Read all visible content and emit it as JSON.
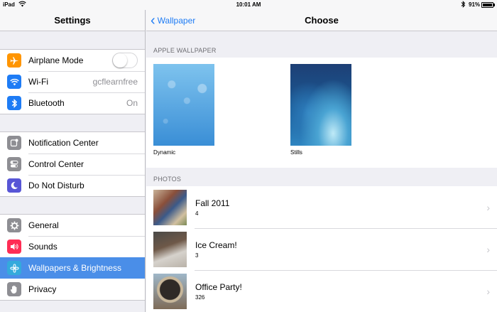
{
  "status_bar": {
    "device": "iPad",
    "wifi_icon": "wifi-icon",
    "time": "10:01 AM",
    "bluetooth_icon": "bluetooth-icon",
    "battery": "91%"
  },
  "sidebar": {
    "title": "Settings",
    "groups": [
      [
        {
          "label": "Airplane Mode",
          "icon": "airplane-icon",
          "color": "#ff9500",
          "control": "toggle",
          "toggle_on": false
        },
        {
          "label": "Wi-Fi",
          "icon": "wifi-icon",
          "color": "#1e7cf5",
          "value": "gcflearnfree"
        },
        {
          "label": "Bluetooth",
          "icon": "bluetooth-icon",
          "color": "#1e7cf5",
          "value": "On"
        }
      ],
      [
        {
          "label": "Notification Center",
          "icon": "notification-center-icon",
          "color": "#8e8e93"
        },
        {
          "label": "Control Center",
          "icon": "control-center-icon",
          "color": "#8e8e93"
        },
        {
          "label": "Do Not Disturb",
          "icon": "moon-icon",
          "color": "#5856d6"
        }
      ],
      [
        {
          "label": "General",
          "icon": "gear-icon",
          "color": "#8e8e93"
        },
        {
          "label": "Sounds",
          "icon": "speaker-icon",
          "color": "#ff2d55"
        },
        {
          "label": "Wallpapers & Brightness",
          "icon": "flower-icon",
          "color": "#34aadc",
          "selected": true
        },
        {
          "label": "Privacy",
          "icon": "hand-icon",
          "color": "#8e8e93"
        }
      ]
    ]
  },
  "main": {
    "back_label": "Wallpaper",
    "title": "Choose",
    "apple_section_label": "APPLE WALLPAPER",
    "wallpapers": [
      {
        "caption": "Dynamic"
      },
      {
        "caption": "Stills"
      }
    ],
    "photos_section_label": "PHOTOS",
    "albums": [
      {
        "name": "Fall 2011",
        "count": "4"
      },
      {
        "name": "Ice Cream!",
        "count": "3"
      },
      {
        "name": "Office Party!",
        "count": "326"
      }
    ]
  },
  "colors": {
    "accent": "#1e7cf5",
    "selected_row": "#4a8ee8",
    "background": "#efeff4"
  }
}
